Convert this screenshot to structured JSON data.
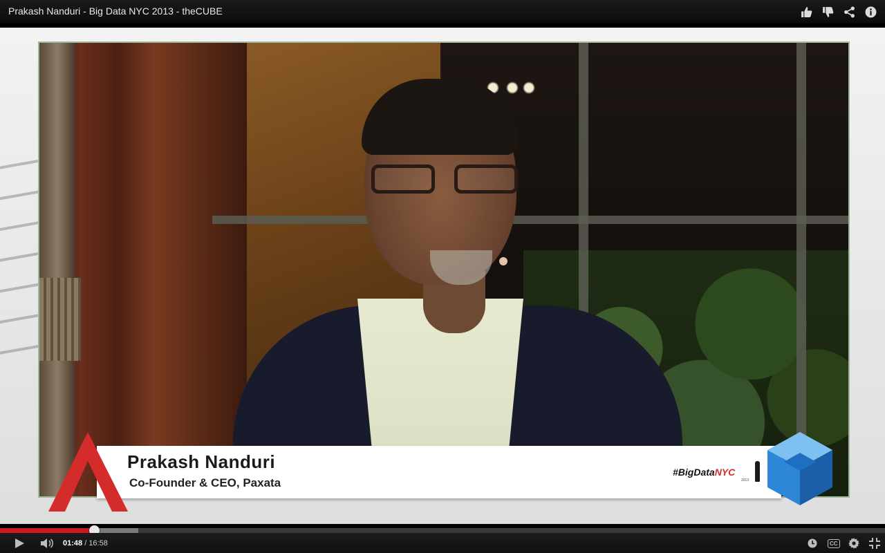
{
  "window": {
    "video_title": "Prakash Nanduri - Big Data NYC 2013 - theCUBE"
  },
  "top_actions": [
    {
      "icon": "thumbs-up-icon"
    },
    {
      "icon": "thumbs-down-icon"
    },
    {
      "icon": "share-icon"
    },
    {
      "icon": "info-icon"
    }
  ],
  "overlay": {
    "speaker_name": "Prakash Nanduri",
    "speaker_title": "Co-Founder & CEO, Paxata",
    "hashtag_prefix": "#BigData",
    "hashtag_suffix": "NYC",
    "hashtag_year": "2013",
    "accent_color": "#d42b2b",
    "cube_color": "#2e86d6"
  },
  "player": {
    "current_time": "01:48",
    "separator": " / ",
    "duration": "16:58",
    "progress_fraction": 0.106,
    "buffered_fraction": 0.156,
    "controls": [
      "play-icon",
      "volume-icon",
      "watch-later-icon",
      "captions-icon",
      "settings-gear-icon",
      "exit-fullscreen-icon"
    ],
    "captions_label": "CC",
    "played_color": "#cc181e"
  }
}
